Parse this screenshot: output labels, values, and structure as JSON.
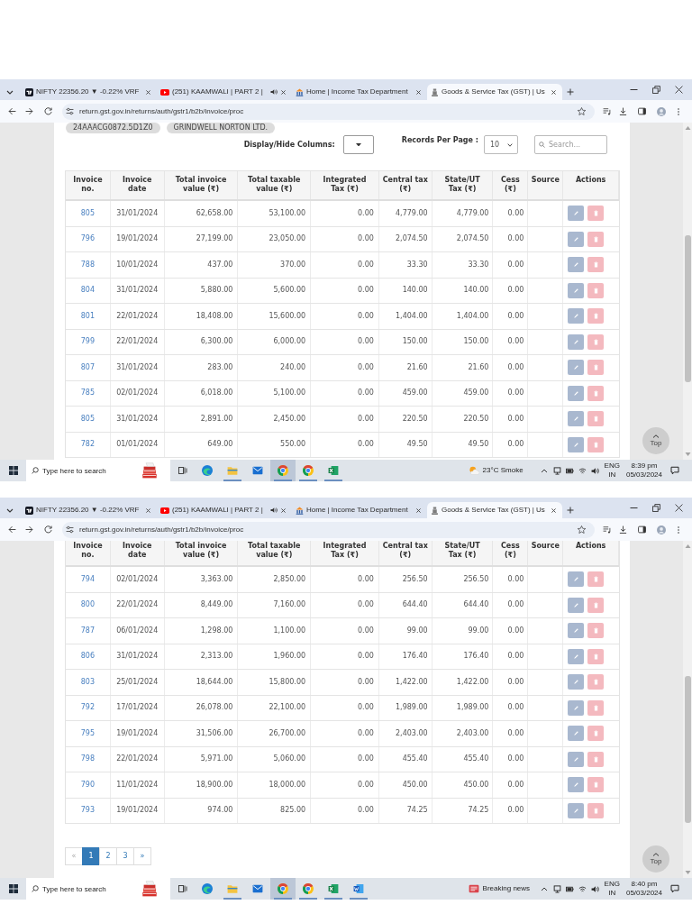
{
  "screenshots": [
    {
      "tabs": [
        {
          "kind": "chart",
          "title": "NIFTY 22356.20 ▼ -0.22% VRF",
          "audio": false,
          "selected": false
        },
        {
          "kind": "video",
          "title": "(251) KAAMWALI | PART 2 |",
          "audio": true,
          "selected": false
        },
        {
          "kind": "tax",
          "title": "Home | Income Tax Department",
          "audio": false,
          "selected": false
        },
        {
          "kind": "emblem",
          "title": "Goods & Service Tax (GST) | Us",
          "audio": false,
          "selected": true
        }
      ],
      "address": "return.gst.gov.in/returns/auth/gstr1/b2b/invoice/proc",
      "chips": [
        "24AAACG0872.5D1Z0",
        "GRINDWELL NORTON LTD."
      ],
      "controls": {
        "columns_label": "Display/Hide Columns:",
        "records_label": "Records Per Page :",
        "records_value": "10",
        "search_placeholder": "Search..."
      },
      "table": {
        "columns": [
          "Invoice\nno.",
          "Invoice\ndate",
          "Total invoice\nvalue (₹)",
          "Total taxable\nvalue (₹)",
          "Integrated\nTax (₹)",
          "Central tax\n(₹)",
          "State/UT\nTax (₹)",
          "Cess\n(₹)",
          "Source",
          "Actions"
        ],
        "rows": [
          {
            "cells": [
              "805",
              "31/01/2024",
              "62,658.00",
              "53,100.00",
              "0.00",
              "4,779.00",
              "4,779.00",
              "0.00"
            ]
          },
          {
            "cells": [
              "796",
              "19/01/2024",
              "27,199.00",
              "23,050.00",
              "0.00",
              "2,074.50",
              "2,074.50",
              "0.00"
            ]
          },
          {
            "cells": [
              "788",
              "10/01/2024",
              "437.00",
              "370.00",
              "0.00",
              "33.30",
              "33.30",
              "0.00"
            ]
          },
          {
            "cells": [
              "804",
              "31/01/2024",
              "5,880.00",
              "5,600.00",
              "0.00",
              "140.00",
              "140.00",
              "0.00"
            ]
          },
          {
            "cells": [
              "801",
              "22/01/2024",
              "18,408.00",
              "15,600.00",
              "0.00",
              "1,404.00",
              "1,404.00",
              "0.00"
            ]
          },
          {
            "cells": [
              "799",
              "22/01/2024",
              "6,300.00",
              "6,000.00",
              "0.00",
              "150.00",
              "150.00",
              "0.00"
            ]
          },
          {
            "cells": [
              "807",
              "31/01/2024",
              "283.00",
              "240.00",
              "0.00",
              "21.60",
              "21.60",
              "0.00"
            ]
          },
          {
            "cells": [
              "785",
              "02/01/2024",
              "6,018.00",
              "5,100.00",
              "0.00",
              "459.00",
              "459.00",
              "0.00"
            ]
          },
          {
            "cells": [
              "805",
              "31/01/2024",
              "2,891.00",
              "2,450.00",
              "0.00",
              "220.50",
              "220.50",
              "0.00"
            ]
          },
          {
            "cells": [
              "782",
              "01/01/2024",
              "649.00",
              "550.00",
              "0.00",
              "49.50",
              "49.50",
              "0.00"
            ]
          }
        ]
      },
      "top_button": "Top",
      "taskbar": {
        "search_placeholder": "Type here to search",
        "apps": [
          {
            "kind": "edge",
            "running": false,
            "selected": false
          },
          {
            "kind": "folder",
            "running": true,
            "selected": false
          },
          {
            "kind": "mail",
            "running": false,
            "selected": false
          },
          {
            "kind": "chrome",
            "running": true,
            "selected": true
          },
          {
            "kind": "chrome",
            "running": true,
            "selected": false
          },
          {
            "kind": "excel",
            "running": true,
            "selected": false
          }
        ],
        "widget": {
          "kind": "weather",
          "label": "23°C Smoke"
        },
        "language": "ENG",
        "region": "IN",
        "time": "8:39 pm",
        "date": "05/03/2024"
      }
    },
    {
      "tabs": [
        {
          "kind": "chart",
          "title": "NIFTY 22356.20 ▼ -0.22% VRF",
          "audio": false,
          "selected": false
        },
        {
          "kind": "video",
          "title": "(251) KAAMWALI | PART 2 |",
          "audio": true,
          "selected": false
        },
        {
          "kind": "tax",
          "title": "Home | Income Tax Department",
          "audio": false,
          "selected": false
        },
        {
          "kind": "emblem",
          "title": "Goods & Service Tax (GST) | Us",
          "audio": false,
          "selected": true
        }
      ],
      "address": "return.gst.gov.in/returns/auth/gstr1/b2b/invoice/proc",
      "table": {
        "columns": [
          "Invoice\nno.",
          "Invoice\ndate",
          "Total invoice\nvalue (₹)",
          "Total taxable\nvalue (₹)",
          "Integrated\nTax (₹)",
          "Central tax\n(₹)",
          "State/UT\nTax (₹)",
          "Cess\n(₹)",
          "Source",
          "Actions"
        ],
        "rows": [
          {
            "cells": [
              "794",
              "02/01/2024",
              "3,363.00",
              "2,850.00",
              "0.00",
              "256.50",
              "256.50",
              "0.00"
            ]
          },
          {
            "cells": [
              "800",
              "22/01/2024",
              "8,449.00",
              "7,160.00",
              "0.00",
              "644.40",
              "644.40",
              "0.00"
            ]
          },
          {
            "cells": [
              "787",
              "06/01/2024",
              "1,298.00",
              "1,100.00",
              "0.00",
              "99.00",
              "99.00",
              "0.00"
            ]
          },
          {
            "cells": [
              "806",
              "31/01/2024",
              "2,313.00",
              "1,960.00",
              "0.00",
              "176.40",
              "176.40",
              "0.00"
            ]
          },
          {
            "cells": [
              "803",
              "25/01/2024",
              "18,644.00",
              "15,800.00",
              "0.00",
              "1,422.00",
              "1,422.00",
              "0.00"
            ]
          },
          {
            "cells": [
              "792",
              "17/01/2024",
              "26,078.00",
              "22,100.00",
              "0.00",
              "1,989.00",
              "1,989.00",
              "0.00"
            ]
          },
          {
            "cells": [
              "795",
              "19/01/2024",
              "31,506.00",
              "26,700.00",
              "0.00",
              "2,403.00",
              "2,403.00",
              "0.00"
            ]
          },
          {
            "cells": [
              "798",
              "22/01/2024",
              "5,971.00",
              "5,060.00",
              "0.00",
              "455.40",
              "455.40",
              "0.00"
            ]
          },
          {
            "cells": [
              "790",
              "11/01/2024",
              "18,900.00",
              "18,000.00",
              "0.00",
              "450.00",
              "450.00",
              "0.00"
            ]
          },
          {
            "cells": [
              "793",
              "19/01/2024",
              "974.00",
              "825.00",
              "0.00",
              "74.25",
              "74.25",
              "0.00"
            ]
          }
        ]
      },
      "pagination": [
        {
          "label": "«",
          "selected": false,
          "disabled": true
        },
        {
          "label": "1",
          "selected": true,
          "disabled": false
        },
        {
          "label": "2",
          "selected": false,
          "disabled": false
        },
        {
          "label": "3",
          "selected": false,
          "disabled": false
        },
        {
          "label": "»",
          "selected": false,
          "disabled": false
        }
      ],
      "top_button": "Top",
      "taskbar": {
        "search_placeholder": "Type here to search",
        "apps": [
          {
            "kind": "edge",
            "running": false,
            "selected": false
          },
          {
            "kind": "folder",
            "running": true,
            "selected": false
          },
          {
            "kind": "mail",
            "running": false,
            "selected": false
          },
          {
            "kind": "chrome",
            "running": true,
            "selected": true
          },
          {
            "kind": "chrome",
            "running": true,
            "selected": false
          },
          {
            "kind": "excel",
            "running": true,
            "selected": false
          },
          {
            "kind": "word",
            "running": true,
            "selected": false
          }
        ],
        "widget": {
          "kind": "news",
          "label": "Breaking news"
        },
        "language": "ENG",
        "region": "IN",
        "time": "8:40 pm",
        "date": "05/03/2024"
      }
    }
  ]
}
